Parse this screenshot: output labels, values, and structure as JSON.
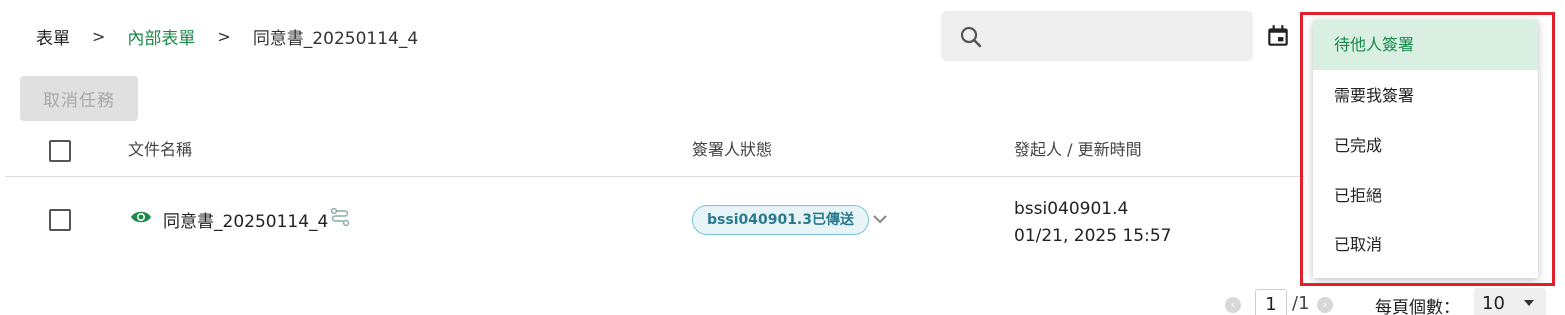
{
  "breadcrumb": {
    "root": "表單",
    "folder": "內部表單",
    "current": "同意書_20250114_4",
    "separator": ">"
  },
  "search": {
    "placeholder": ""
  },
  "toolbar": {
    "cancel_task_label": "取消任務"
  },
  "table": {
    "headers": {
      "file_name": "文件名稱",
      "signer_status": "簽署人狀態",
      "initiator_updated": "發起人 / 更新時間"
    },
    "rows": [
      {
        "name": "同意書_20250114_4",
        "signer_status": "bssi040901.3已傳送",
        "initiator": "bssi040901.4",
        "updated": "01/21, 2025 15:57"
      }
    ]
  },
  "pagination": {
    "current_page": "1",
    "total": "/1",
    "per_page_label": "每頁個數：",
    "per_page_value": "10"
  },
  "status_filter_menu": {
    "items": [
      "待他人簽署",
      "需要我簽署",
      "已完成",
      "已拒絕",
      "已取消"
    ],
    "selected": "待他人簽署"
  },
  "colors": {
    "accent_green": "#1a8a4a",
    "active_item_bg": "#d9efe1",
    "highlight_border": "#e0202a",
    "badge_border": "#7cc4d6"
  }
}
